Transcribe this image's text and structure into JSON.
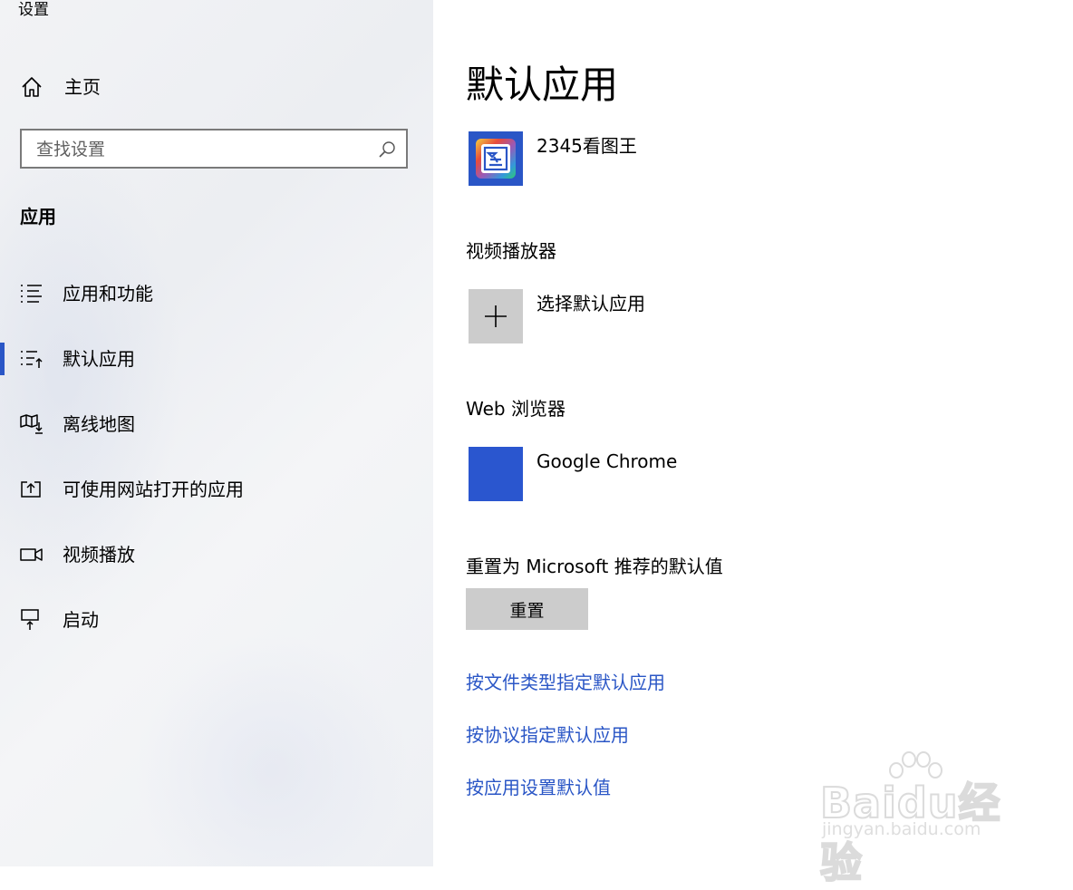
{
  "window": {
    "title": "设置"
  },
  "sidebar": {
    "home_label": "主页",
    "search_placeholder": "查找设置",
    "section_title": "应用",
    "items": [
      {
        "label": "应用和功能",
        "icon": "list-icon"
      },
      {
        "label": "默认应用",
        "icon": "default-apps-icon",
        "selected": true
      },
      {
        "label": "离线地图",
        "icon": "map-download-icon"
      },
      {
        "label": "可使用网站打开的应用",
        "icon": "open-with-icon"
      },
      {
        "label": "视频播放",
        "icon": "video-camera-icon"
      },
      {
        "label": "启动",
        "icon": "startup-icon"
      }
    ]
  },
  "main": {
    "title": "默认应用",
    "photo_viewer": {
      "app_name": "2345看图王",
      "icon": "photo-viewer-app-icon"
    },
    "video_player": {
      "label": "视频播放器",
      "app_name": "选择默认应用",
      "icon": "plus-icon"
    },
    "web_browser": {
      "label": "Web 浏览器",
      "app_name": "Google Chrome",
      "icon": "browser-app-icon"
    },
    "reset": {
      "label": "重置为 Microsoft 推荐的默认值",
      "button": "重置"
    },
    "links": [
      "按文件类型指定默认应用",
      "按协议指定默认应用",
      "按应用设置默认值"
    ]
  },
  "watermark": {
    "brand": "Baidu经验",
    "site": "jingyan.baidu.com"
  },
  "colors": {
    "accent": "#2a56c6",
    "tile_grey": "#cccccc",
    "sidebar_bg": "#eef0f3"
  }
}
